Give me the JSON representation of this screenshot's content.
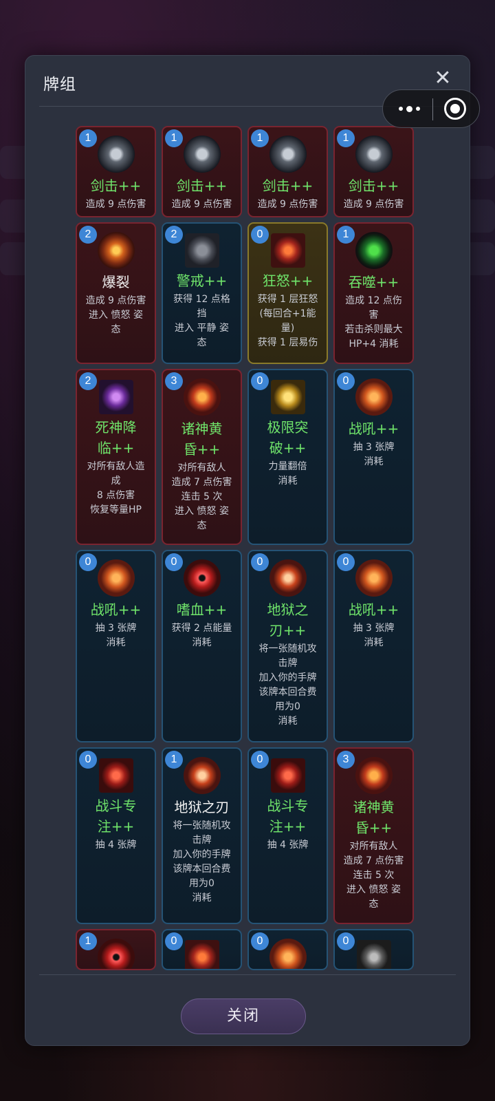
{
  "modal": {
    "title": "牌组",
    "close_icon": "✕",
    "footer_button": "关闭"
  },
  "capsule": {
    "more_icon": "more-icon",
    "target_icon": "record-icon"
  },
  "colors": {
    "attack_border": "#7a2430",
    "skill_border": "#255375",
    "power_border": "#8a7a2a",
    "upgraded_name": "#6fe36a",
    "cost_badge": "#3e86d6"
  },
  "cards": [
    {
      "cost": "1",
      "name": "剑击++",
      "desc": [
        "造成 9 点伤害"
      ],
      "type": "attack",
      "art": "sword-icon"
    },
    {
      "cost": "1",
      "name": "剑击++",
      "desc": [
        "造成 9 点伤害"
      ],
      "type": "attack",
      "art": "sword-icon"
    },
    {
      "cost": "1",
      "name": "剑击++",
      "desc": [
        "造成 9 点伤害"
      ],
      "type": "attack",
      "art": "sword-icon"
    },
    {
      "cost": "1",
      "name": "剑击++",
      "desc": [
        "造成 9 点伤害"
      ],
      "type": "attack",
      "art": "sword-icon"
    },
    {
      "cost": "2",
      "name": "爆裂",
      "desc": [
        "造成 9 点伤害",
        "进入 愤怒 姿",
        "态"
      ],
      "type": "attack",
      "art": "spiral-icon",
      "upgraded": false
    },
    {
      "cost": "2",
      "name": "警戒++",
      "desc": [
        "获得 12 点格",
        "挡",
        "进入 平静 姿",
        "态"
      ],
      "type": "skill",
      "art": "golem-icon"
    },
    {
      "cost": "0",
      "name": "狂怒++",
      "desc": [
        "获得 1 层狂怒",
        "(每回合+1能",
        "量)",
        "获得 1 层易伤"
      ],
      "type": "power",
      "art": "rage-icon"
    },
    {
      "cost": "1",
      "name": "吞噬++",
      "desc": [
        "造成 12 点伤",
        "害",
        "若击杀则最大",
        "HP+4  消耗"
      ],
      "type": "attack",
      "art": "devour-icon"
    },
    {
      "cost": "2",
      "name": "死神降\n临++",
      "desc": [
        "对所有敌人造",
        "成",
        "8 点伤害",
        "恢复等量HP"
      ],
      "type": "attack",
      "art": "death-icon"
    },
    {
      "cost": "3",
      "name": "诸神黄\n昏++",
      "desc": [
        "对所有敌人",
        "造成 7 点伤害",
        "连击 5 次",
        "进入 愤怒 姿",
        "态"
      ],
      "type": "attack",
      "art": "twilight-icon"
    },
    {
      "cost": "0",
      "name": "极限突\n破++",
      "desc": [
        "力量翻倍",
        "消耗"
      ],
      "type": "skill",
      "art": "limit-icon"
    },
    {
      "cost": "0",
      "name": "战吼++",
      "desc": [
        "抽 3 张牌",
        "消耗"
      ],
      "type": "skill",
      "art": "roar-icon"
    },
    {
      "cost": "0",
      "name": "战吼++",
      "desc": [
        "抽 3 张牌",
        "消耗"
      ],
      "type": "skill",
      "art": "roar-icon"
    },
    {
      "cost": "0",
      "name": "嗜血++",
      "desc": [
        "获得 2 点能量",
        "消耗"
      ],
      "type": "skill",
      "art": "blood-icon"
    },
    {
      "cost": "0",
      "name": "地狱之\n刃++",
      "desc": [
        "将一张随机攻",
        "击牌",
        "加入你的手牌",
        "该牌本回合费",
        "用为0",
        "消耗"
      ],
      "type": "skill",
      "art": "hellblade-icon"
    },
    {
      "cost": "0",
      "name": "战吼++",
      "desc": [
        "抽 3 张牌",
        "消耗"
      ],
      "type": "skill",
      "art": "roar-icon"
    },
    {
      "cost": "0",
      "name": "战斗专\n注++",
      "desc": [
        "抽 4 张牌"
      ],
      "type": "skill",
      "art": "focus-icon"
    },
    {
      "cost": "1",
      "name": "地狱之刃",
      "desc": [
        "将一张随机攻",
        "击牌",
        "加入你的手牌",
        "该牌本回合费",
        "用为0",
        "消耗"
      ],
      "type": "skill",
      "art": "hellblade-icon",
      "upgraded": false
    },
    {
      "cost": "0",
      "name": "战斗专\n注++",
      "desc": [
        "抽 4 张牌"
      ],
      "type": "skill",
      "art": "focus-icon"
    },
    {
      "cost": "3",
      "name": "诸神黄\n昏++",
      "desc": [
        "对所有敌人",
        "造成 7 点伤害",
        "连击 5 次",
        "进入 愤怒 姿",
        "态"
      ],
      "type": "attack",
      "art": "twilight-icon"
    },
    {
      "cost": "1",
      "name": "",
      "desc": [],
      "type": "attack",
      "art": "blood-icon",
      "cut": true
    },
    {
      "cost": "0",
      "name": "",
      "desc": [],
      "type": "skill",
      "art": "rage-icon",
      "cut": true
    },
    {
      "cost": "0",
      "name": "",
      "desc": [],
      "type": "skill",
      "art": "roar-icon",
      "cut": true
    },
    {
      "cost": "0",
      "name": "",
      "desc": [],
      "type": "skill",
      "art": "skull-icon",
      "cut": true
    }
  ]
}
